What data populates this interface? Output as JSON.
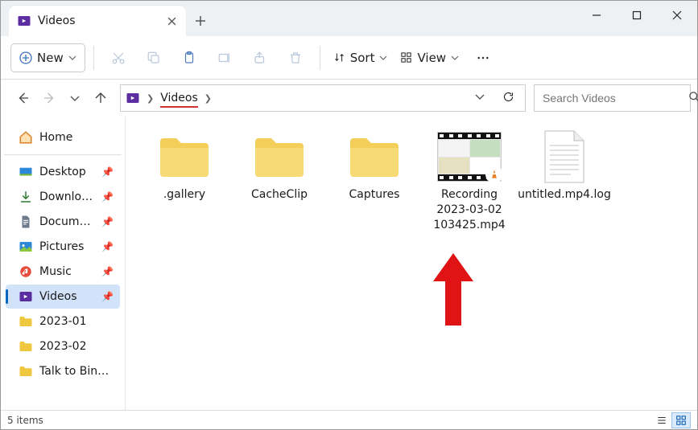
{
  "tab": {
    "title": "Videos"
  },
  "toolbar": {
    "new": "New",
    "sort": "Sort",
    "view": "View"
  },
  "breadcrumb": {
    "current": "Videos"
  },
  "search": {
    "placeholder": "Search Videos"
  },
  "sidebar": {
    "home": "Home",
    "quick": [
      {
        "label": "Desktop"
      },
      {
        "label": "Downloads"
      },
      {
        "label": "Documents"
      },
      {
        "label": "Pictures"
      },
      {
        "label": "Music"
      },
      {
        "label": "Videos"
      }
    ],
    "folders": [
      {
        "label": "2023-01"
      },
      {
        "label": "2023-02"
      },
      {
        "label": "Talk to Bing AI"
      }
    ]
  },
  "items": [
    {
      "name": ".gallery",
      "type": "folder"
    },
    {
      "name": "CacheClip",
      "type": "folder"
    },
    {
      "name": "Captures",
      "type": "folder"
    },
    {
      "name": "Recording 2023-03-02 103425.mp4",
      "type": "video"
    },
    {
      "name": "untitled.mp4.log",
      "type": "log"
    }
  ],
  "status": {
    "count": "5 items"
  }
}
